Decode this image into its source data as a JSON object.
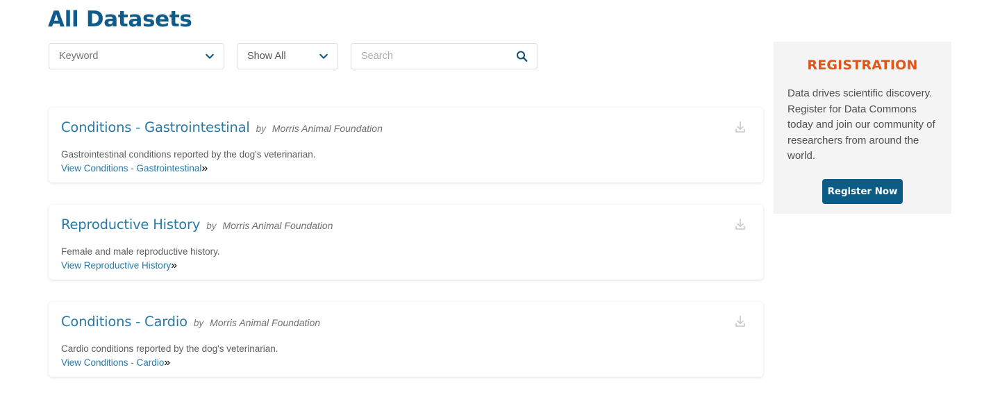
{
  "page": {
    "title": "All Datasets"
  },
  "filters": {
    "keyword_select": {
      "value": "Keyword",
      "icon": "chevron-down-icon"
    },
    "show_select": {
      "value": "Show All",
      "icon": "chevron-down-icon"
    },
    "search": {
      "value": "",
      "placeholder": "Search",
      "icon": "search-icon"
    }
  },
  "datasets": [
    {
      "title": "Conditions - Gastrointestinal",
      "by_label": "by",
      "publisher": "Morris Animal Foundation",
      "description": "Gastrointestinal conditions reported by the dog's veterinarian.",
      "link_label": "View Conditions - Gastrointestinal",
      "link_chevron": "»",
      "download_icon": "download-icon"
    },
    {
      "title": "Reproductive History",
      "by_label": "by",
      "publisher": "Morris Animal Foundation",
      "description": "Female and male reproductive history.",
      "link_label": "View Reproductive History",
      "link_chevron": "»",
      "download_icon": "download-icon"
    },
    {
      "title": "Conditions - Cardio",
      "by_label": "by",
      "publisher": "Morris Animal Foundation",
      "description": "Cardio conditions reported by the dog's veterinarian.",
      "link_label": "View Conditions - Cardio",
      "link_chevron": "»",
      "download_icon": "download-icon"
    }
  ],
  "registration": {
    "heading": "REGISTRATION",
    "body": "Data drives scientific discovery. Register for Data Commons today and join our community of researchers from around the world.",
    "button_label": "Register Now"
  },
  "colors": {
    "page_title": "#0f5c8c",
    "card_title_link": "#2a7aa6",
    "registration_heading": "#e1551a",
    "register_button": "#0d5c86",
    "panel_background": "#f4f4f4",
    "body_text": "#5c6063"
  }
}
